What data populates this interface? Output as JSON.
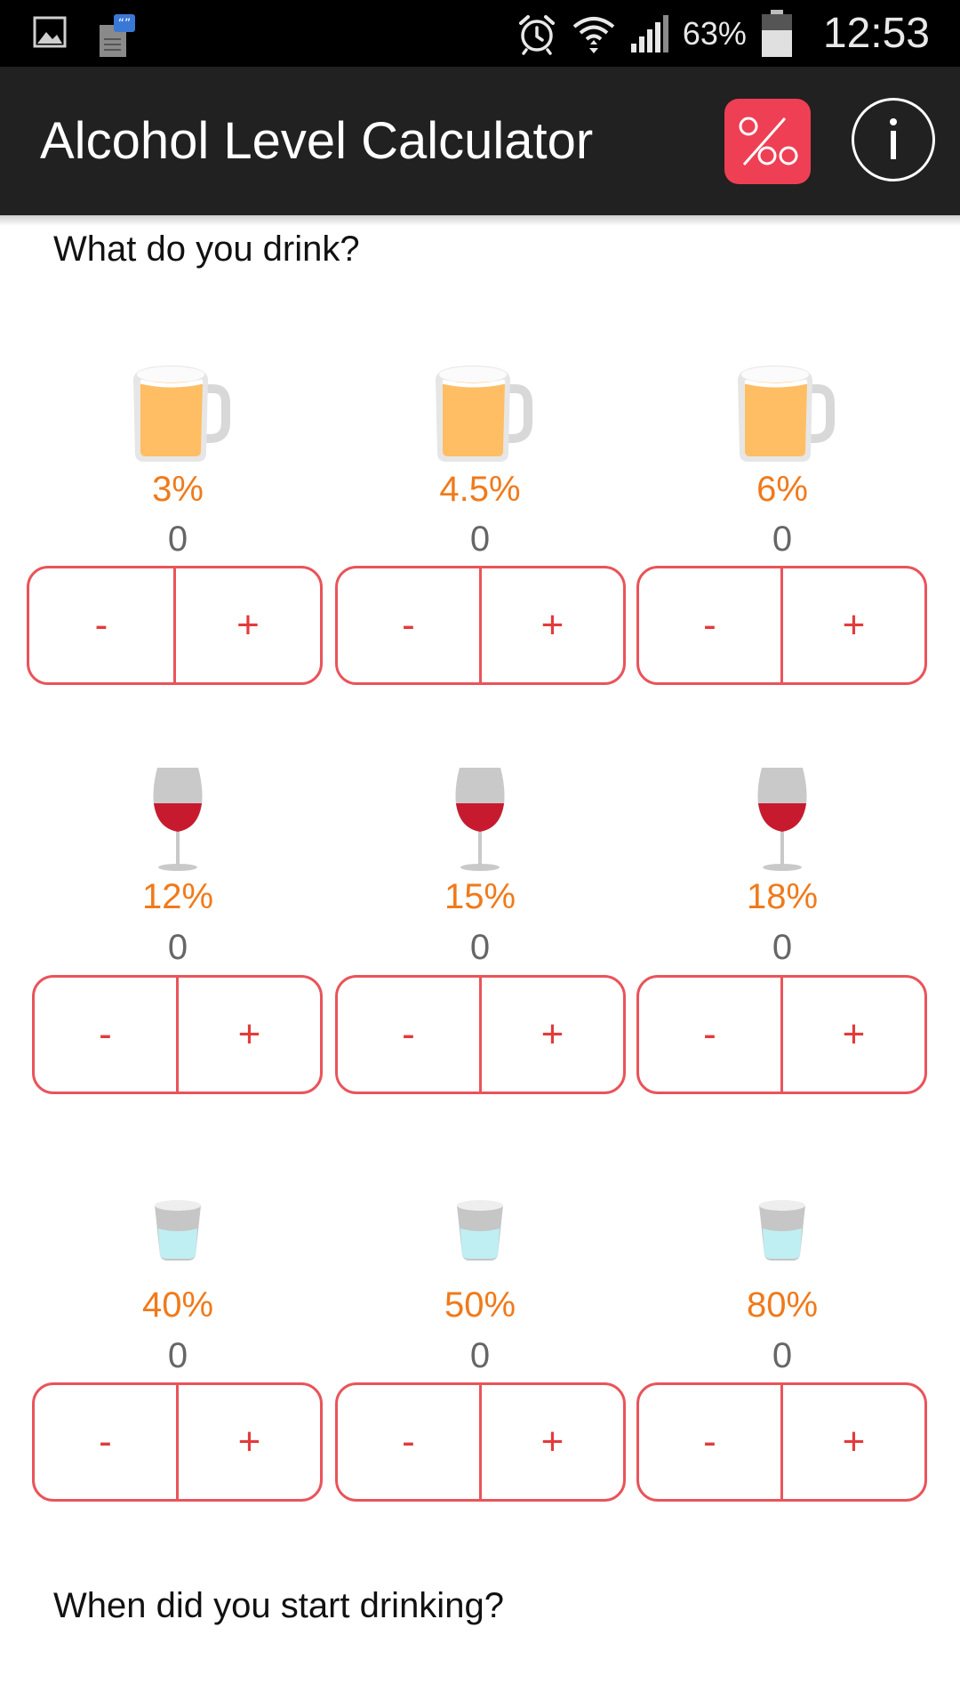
{
  "status_bar": {
    "icons_left": [
      "gallery-notification-icon",
      "messaging-notification-icon"
    ],
    "icons_right": [
      "alarm-icon",
      "wifi-icon",
      "signal-icon",
      "battery-icon"
    ],
    "battery": "63%",
    "time": "12:53"
  },
  "app_bar": {
    "title": "Alcohol Level Calculator",
    "promille_icon": "per-mille-icon",
    "info_icon": "info-icon"
  },
  "section_drinks": {
    "heading": "What do you drink?"
  },
  "drinks": [
    {
      "type": "beer",
      "icon": "beer-mug-icon",
      "percent": "3%",
      "count": "0",
      "minus": "-",
      "plus": "+"
    },
    {
      "type": "beer",
      "icon": "beer-mug-icon",
      "percent": "4.5%",
      "count": "0",
      "minus": "-",
      "plus": "+"
    },
    {
      "type": "beer",
      "icon": "beer-mug-icon",
      "percent": "6%",
      "count": "0",
      "minus": "-",
      "plus": "+"
    },
    {
      "type": "wine",
      "icon": "wine-glass-icon",
      "percent": "12%",
      "count": "0",
      "minus": "-",
      "plus": "+"
    },
    {
      "type": "wine",
      "icon": "wine-glass-icon",
      "percent": "15%",
      "count": "0",
      "minus": "-",
      "plus": "+"
    },
    {
      "type": "wine",
      "icon": "wine-glass-icon",
      "percent": "18%",
      "count": "0",
      "minus": "-",
      "plus": "+"
    },
    {
      "type": "spirit",
      "icon": "shot-glass-icon",
      "percent": "40%",
      "count": "0",
      "minus": "-",
      "plus": "+"
    },
    {
      "type": "spirit",
      "icon": "shot-glass-icon",
      "percent": "50%",
      "count": "0",
      "minus": "-",
      "plus": "+"
    },
    {
      "type": "spirit",
      "icon": "shot-glass-icon",
      "percent": "80%",
      "count": "0",
      "minus": "-",
      "plus": "+"
    }
  ],
  "section_start": {
    "heading": "When did you start drinking?"
  },
  "colors": {
    "status_bar": "#000000",
    "app_bar": "#212121",
    "accent_red": "#e23b3b",
    "percent_orange": "#f07a1b",
    "count_grey": "#666666",
    "promille_button": "#ef3f54"
  }
}
